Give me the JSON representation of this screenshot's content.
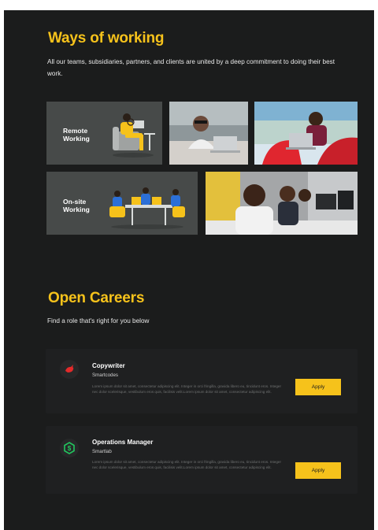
{
  "ways": {
    "heading": "Ways of working",
    "intro": "All our teams, subsidiaries, partners, and clients are united by a deep commitment to doing their best work.",
    "tiles": [
      {
        "label": "Remote\nWorking"
      },
      {
        "label": "On-site\nWorking"
      }
    ]
  },
  "careers": {
    "heading": "Open Careers",
    "subheading": "Find a role that's right for you below",
    "jobs": [
      {
        "title": "Copywriter",
        "company": "Smartcodes",
        "description": "Lorem ipsum dolor sit amet, consectetur adipiscing elit. Integer in orci fringilla, gravida libero eu, tincidunt eros. Integer nec dolor scelerisque, vestibulum eros quis, facilisis velit.Lorem ipsum dolor sit amet, consectetur adipiscing elit.",
        "apply_label": "Apply"
      },
      {
        "title": "Operations Manager",
        "company": "Smartlab",
        "description": "Lorem ipsum dolor sit amet, consectetur adipiscing elit. Integer in orci fringilla, gravida libero eu, tincidunt eros. Integer nec dolor scelerisque, vestibulum eros quis, facilisis velit.Lorem ipsum dolor sit amet, consectetur adipiscing elit.",
        "apply_label": "Apply"
      }
    ]
  },
  "colors": {
    "accent": "#f6c21b",
    "background": "#1b1c1c",
    "card": "#1f2021",
    "tile": "#474a49"
  }
}
